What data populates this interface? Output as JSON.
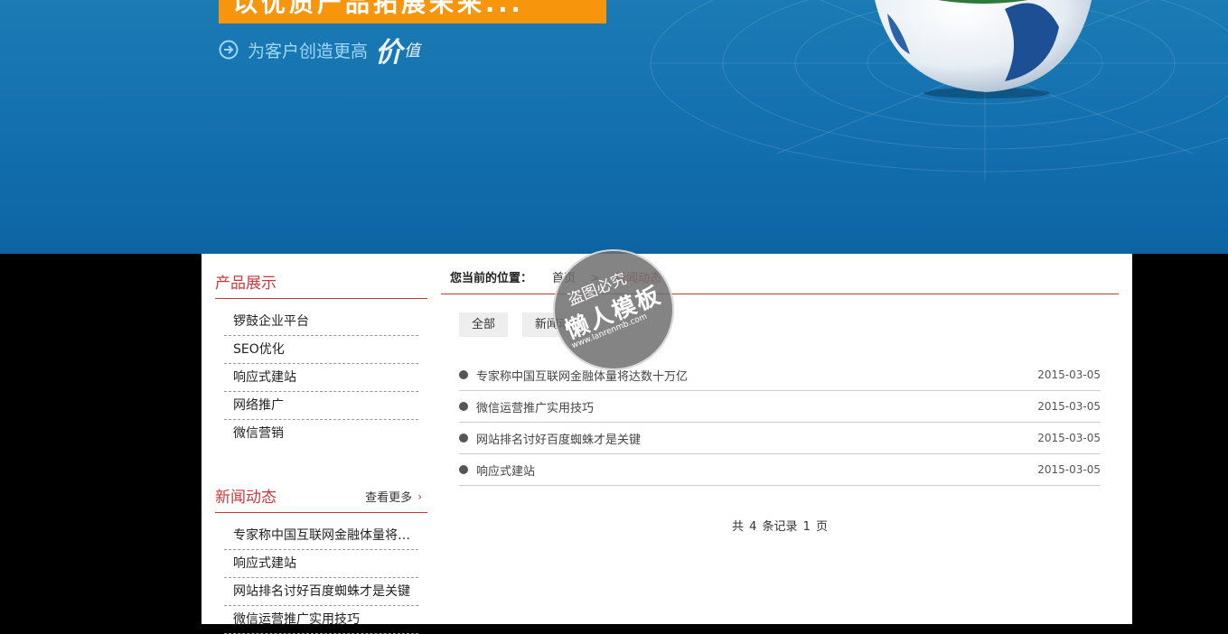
{
  "banner": {
    "headline": "以优质产品拓展未来...",
    "slogan_prefix": "为客户创造更高",
    "slogan_big": "价",
    "slogan_small": "值"
  },
  "sidebar": {
    "products": {
      "title": "产品展示",
      "items": [
        "锣鼓企业平台",
        "SEO优化",
        "响应式建站",
        "网络推广",
        "微信营销"
      ]
    },
    "news": {
      "title": "新闻动态",
      "more_label": "查看更多",
      "items": [
        "专家称中国互联网金融体量将达数十万亿",
        "响应式建站",
        "网站排名讨好百度蜘蛛才是关键",
        "微信运营推广实用技巧"
      ]
    }
  },
  "breadcrumb": {
    "label": "您当前的位置：",
    "home": "首页",
    "separator": ">",
    "current": "新闻动态"
  },
  "tabs": [
    "全部",
    "新闻动态"
  ],
  "news_list": [
    {
      "title": "专家称中国互联网金融体量将达数十万亿",
      "date": "2015-03-05"
    },
    {
      "title": "微信运营推广实用技巧",
      "date": "2015-03-05"
    },
    {
      "title": "网站排名讨好百度蜘蛛才是关键",
      "date": "2015-03-05"
    },
    {
      "title": "响应式建站",
      "date": "2015-03-05"
    }
  ],
  "pager": "共 4 条记录 1 页",
  "watermark": {
    "line1": "盗图必究",
    "line2": "懒人模板",
    "line3": "www.lanrenmb.com"
  },
  "colors": {
    "accent": "#c9393c",
    "banner_blue": "#136fae",
    "headline_orange": "#f7960d"
  }
}
